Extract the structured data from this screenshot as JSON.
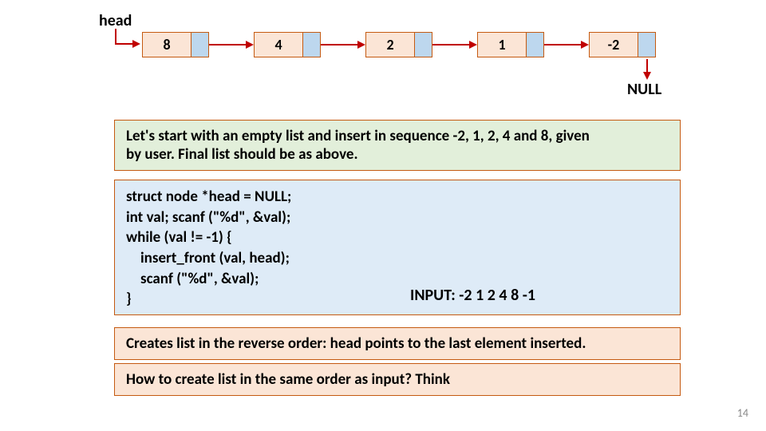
{
  "head_label": "head",
  "nodes": [
    "8",
    "4",
    "2",
    "1",
    "-2"
  ],
  "null_label": "NULL",
  "desc": {
    "line1": "Let's start with an empty list and insert in sequence -2, 1, 2, 4 and 8, given",
    "line2": "by user. Final list should be as above."
  },
  "code": {
    "l1": "struct node *head = NULL;",
    "l2": "int val; scanf (\"%d\", &val);",
    "l3": "while (val != -1) {",
    "l4": "insert_front (val, head);",
    "l5": "scanf (\"%d\", &val);",
    "l6": "}"
  },
  "input_label": "INPUT: -2 1 2 4 8 -1",
  "note1": "Creates list in the reverse order: head points to the last element inserted.",
  "note2": "How to create list in the same order as input? Think",
  "page_number": "14"
}
